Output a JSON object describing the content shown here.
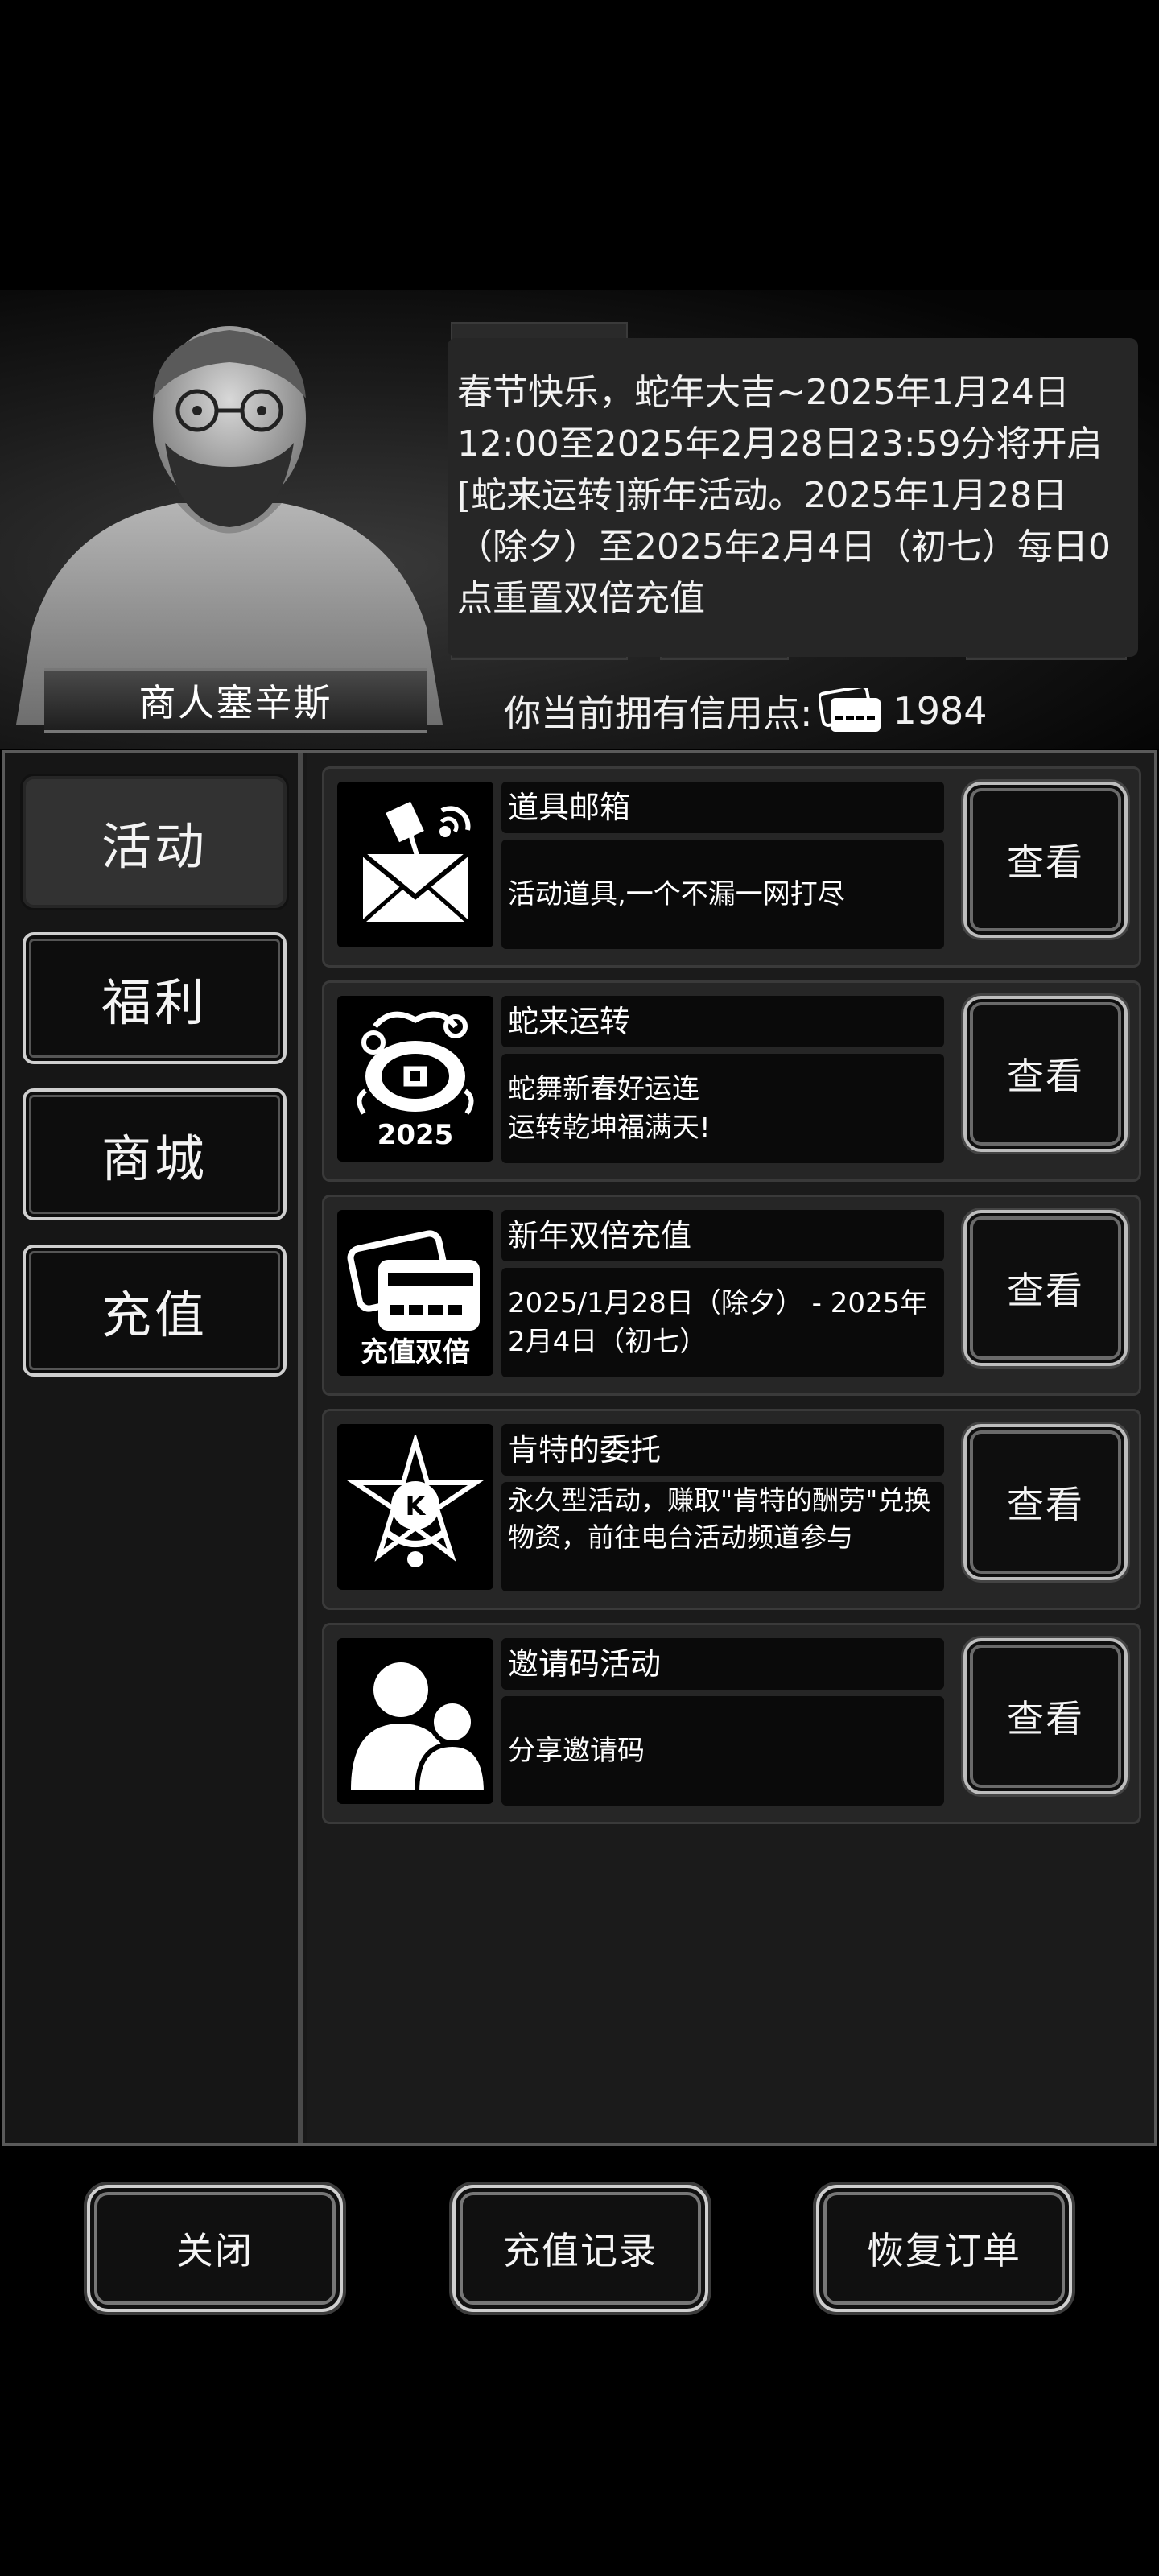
{
  "merchant": {
    "name": "商人塞辛斯",
    "dialog": "春节快乐，蛇年大吉~2025年1月24日12:00至2025年2月28日23:59分将开启[蛇来运转]新年活动。2025年1月28日（除夕）至2025年2月4日（初七）每日0点重置双倍充值",
    "credit_label": "你当前拥有信用点:",
    "credit_icon": "credit-card-icon",
    "credit_value": "1984"
  },
  "sidebar": {
    "tabs": [
      {
        "label": "活动",
        "active": true
      },
      {
        "label": "福利",
        "active": false
      },
      {
        "label": "商城",
        "active": false
      },
      {
        "label": "充值",
        "active": false
      }
    ]
  },
  "activities": [
    {
      "title": "道具邮箱",
      "desc": "活动道具,一个不漏一网打尽",
      "icon": "mail-satellite-icon",
      "button": "查看"
    },
    {
      "title": "蛇来运转",
      "desc": "蛇舞新春好运连\n运转乾坤福满天!",
      "icon": "snake-year-2025-icon",
      "icon_text": "2025",
      "button": "查看"
    },
    {
      "title": "新年双倍充值",
      "desc": "2025/1月28日（除夕） - 2025年2月4日（初七）",
      "icon": "double-recharge-icon",
      "icon_text": "充值双倍",
      "button": "查看"
    },
    {
      "title": "肯特的委托",
      "desc": "永久型活动，赚取\"肯特的酬劳\"兑换物资，前往电台活动频道参与",
      "icon": "kent-emblem-icon",
      "icon_text": "K",
      "button": "查看"
    },
    {
      "title": "邀请码活动",
      "desc": "分享邀请码",
      "icon": "users-icon",
      "button": "查看"
    }
  ],
  "footer": {
    "close_label": "关闭",
    "history_label": "充值记录",
    "restore_label": "恢复订单"
  }
}
